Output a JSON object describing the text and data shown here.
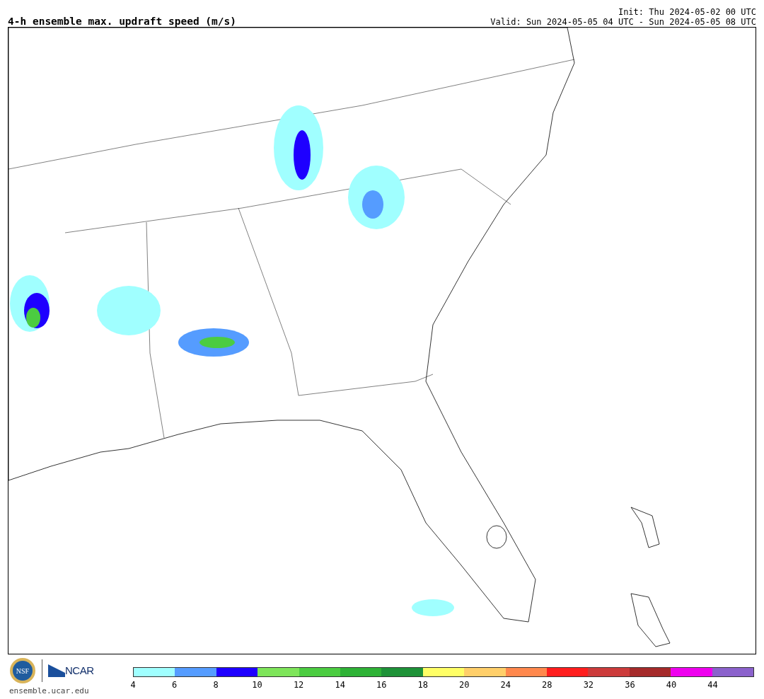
{
  "header": {
    "title": "4-h ensemble max. updraft speed (m/s)",
    "init": "Init: Thu 2024-05-02 00 UTC",
    "valid": "Valid: Sun 2024-05-05 04 UTC - Sun 2024-05-05 08 UTC"
  },
  "footer": {
    "nsf_logo": "NSF",
    "ncar_logo": "NCAR",
    "site": "ensemble.ucar.edu"
  },
  "colorbar": {
    "bins": [
      {
        "color": "#a0ffff"
      },
      {
        "color": "#559cff"
      },
      {
        "color": "#1e00ff"
      },
      {
        "color": "#7ee55a"
      },
      {
        "color": "#4bcc41"
      },
      {
        "color": "#2eb236"
      },
      {
        "color": "#1e9238"
      },
      {
        "color": "#ffff66"
      },
      {
        "color": "#ffcf6a"
      },
      {
        "color": "#ff884d"
      },
      {
        "color": "#ff1e1e"
      },
      {
        "color": "#cc3b3b"
      },
      {
        "color": "#a52a2a"
      },
      {
        "color": "#ee00ee"
      },
      {
        "color": "#8b62cc"
      }
    ],
    "ticks": [
      "4",
      "6",
      "8",
      "10",
      "12",
      "14",
      "16",
      "18",
      "20",
      "24",
      "28",
      "32",
      "36",
      "40",
      "44"
    ]
  }
}
